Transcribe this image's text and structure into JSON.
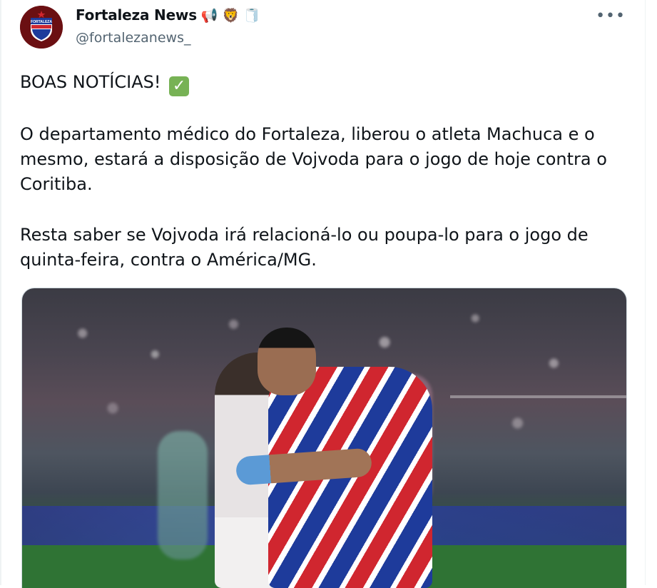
{
  "author": {
    "display_name": "Fortaleza News",
    "handle": "@fortalezanews_",
    "emojis": [
      "📢",
      "🦁",
      "🧻"
    ],
    "avatar_label": "FORTALEZA"
  },
  "menu": {
    "more_label": "•••"
  },
  "tweet": {
    "paragraphs": [
      "BOAS NOTÍCIAS!",
      "O departamento médico do Fortaleza, liberou o atleta Machuca e o\nmesmo, estará a disposição de Vojvoda para o jogo de hoje contra o\nCoritiba.",
      "Resta saber se Vojvoda irá relacioná-lo ou poupa-lo para o jogo de\nquinta-feira, contra o América/MG."
    ],
    "check_emoji": "✓"
  },
  "media": {
    "description": "Fortaleza player in red-blue-white striped kit running with a Coritiba player behind in a stadium"
  },
  "colors": {
    "text": "#0f1419",
    "secondary": "#536471",
    "avatar_bg": "#6b0f12",
    "check_green": "#77b255"
  }
}
